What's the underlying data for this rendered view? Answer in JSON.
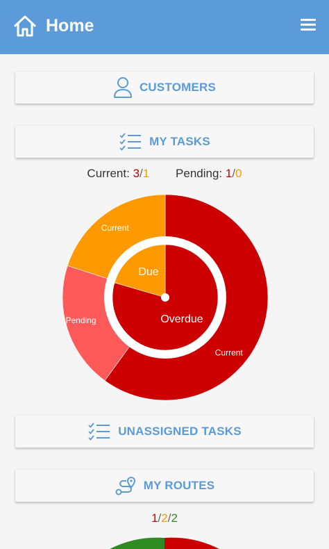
{
  "header": {
    "title": "Home",
    "home_icon": "home-icon",
    "menu_icon": "hamburger-menu-icon",
    "background": "#5c9bd9"
  },
  "customers": {
    "label": "CUSTOMERS",
    "icon": "user-icon"
  },
  "my_tasks": {
    "label": "MY TASKS",
    "icon": "checklist-icon",
    "current_label": "Current:",
    "current_overdue": "3",
    "current_due": "1",
    "pending_label": "Pending:",
    "pending_overdue": "1",
    "pending_due": "0",
    "separator": "/"
  },
  "chart_data": {
    "type": "pie",
    "variant": "nested-donut",
    "inner": {
      "labels": [
        "Due",
        "Overdue"
      ],
      "values": [
        1,
        3
      ],
      "colors": [
        "#ff9900",
        "#cc0000"
      ]
    },
    "outer": {
      "labels": [
        "Current",
        "Current",
        "Pending"
      ],
      "values": [
        3,
        1,
        1
      ],
      "colors": [
        "#cc0000",
        "#ff9900",
        "#ff5a5a"
      ]
    }
  },
  "unassigned_tasks": {
    "label": "UNASSIGNED TASKS",
    "icon": "checklist-icon"
  },
  "my_routes": {
    "label": "MY ROUTES",
    "icon": "route-icon",
    "count_a": "1",
    "count_b": "2",
    "count_c": "2",
    "separator": "/"
  },
  "colors": {
    "accent": "#5b9bd5",
    "overdue": "#cc0000",
    "due": "#ff9900",
    "pending": "#ff5a5a",
    "complete": "#2e8b22"
  }
}
